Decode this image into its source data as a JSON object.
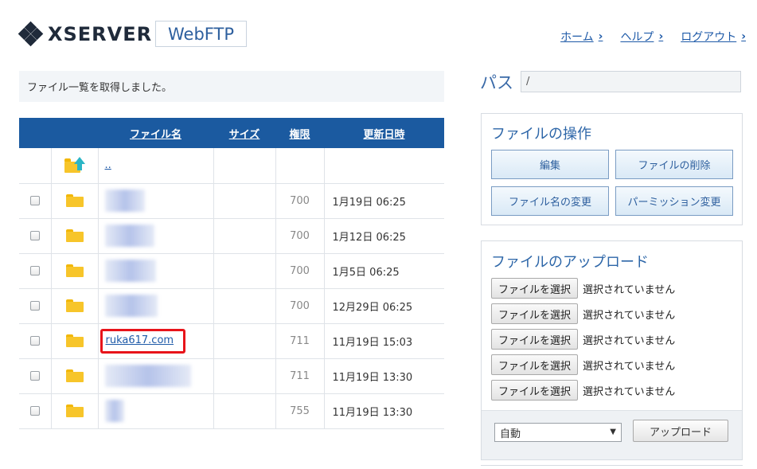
{
  "header": {
    "brand": "XSERVER",
    "product": "WebFTP",
    "nav": [
      {
        "label": "ホーム"
      },
      {
        "label": "ヘルプ"
      },
      {
        "label": "ログアウト"
      }
    ]
  },
  "status_message": "ファイル一覧を取得しました。",
  "table": {
    "headers": {
      "name": "ファイル名",
      "size": "サイズ",
      "perm": "権限",
      "date": "更新日時"
    },
    "parent": {
      "name": ".."
    },
    "rows": [
      {
        "name": "",
        "perm": "700",
        "date": "1月19日 06:25",
        "blurred": true
      },
      {
        "name": "",
        "perm": "700",
        "date": "1月12日 06:25",
        "blurred": true
      },
      {
        "name": "",
        "perm": "700",
        "date": "1月5日 06:25",
        "blurred": true
      },
      {
        "name": "",
        "perm": "700",
        "date": "12月29日 06:25",
        "blurred": true
      },
      {
        "name": "ruka617.com",
        "perm": "711",
        "date": "11月19日 15:03",
        "blurred": false,
        "highlighted": true
      },
      {
        "name": "",
        "perm": "711",
        "date": "11月19日 13:30",
        "blurred": true
      },
      {
        "name": "",
        "perm": "755",
        "date": "11月19日 13:30",
        "blurred": true
      }
    ]
  },
  "path": {
    "label": "パス",
    "value": "/"
  },
  "operations": {
    "title": "ファイルの操作",
    "buttons": {
      "edit": "編集",
      "delete": "ファイルの削除",
      "rename": "ファイル名の変更",
      "permission": "パーミッション変更"
    }
  },
  "upload": {
    "title": "ファイルのアップロード",
    "choose_label": "ファイルを選択",
    "no_file": "選択されていません",
    "mode_selected": "自動",
    "upload_button": "アップロード"
  },
  "colors": {
    "header_bg": "#1b5aa0",
    "accent": "#2d66a8",
    "highlight": "#e8141a",
    "folder": "#f7c52a"
  },
  "icons": [
    "parent-folder-icon",
    "folder-icon",
    "chevron-right-icon",
    "xserver-logo-icon"
  ]
}
